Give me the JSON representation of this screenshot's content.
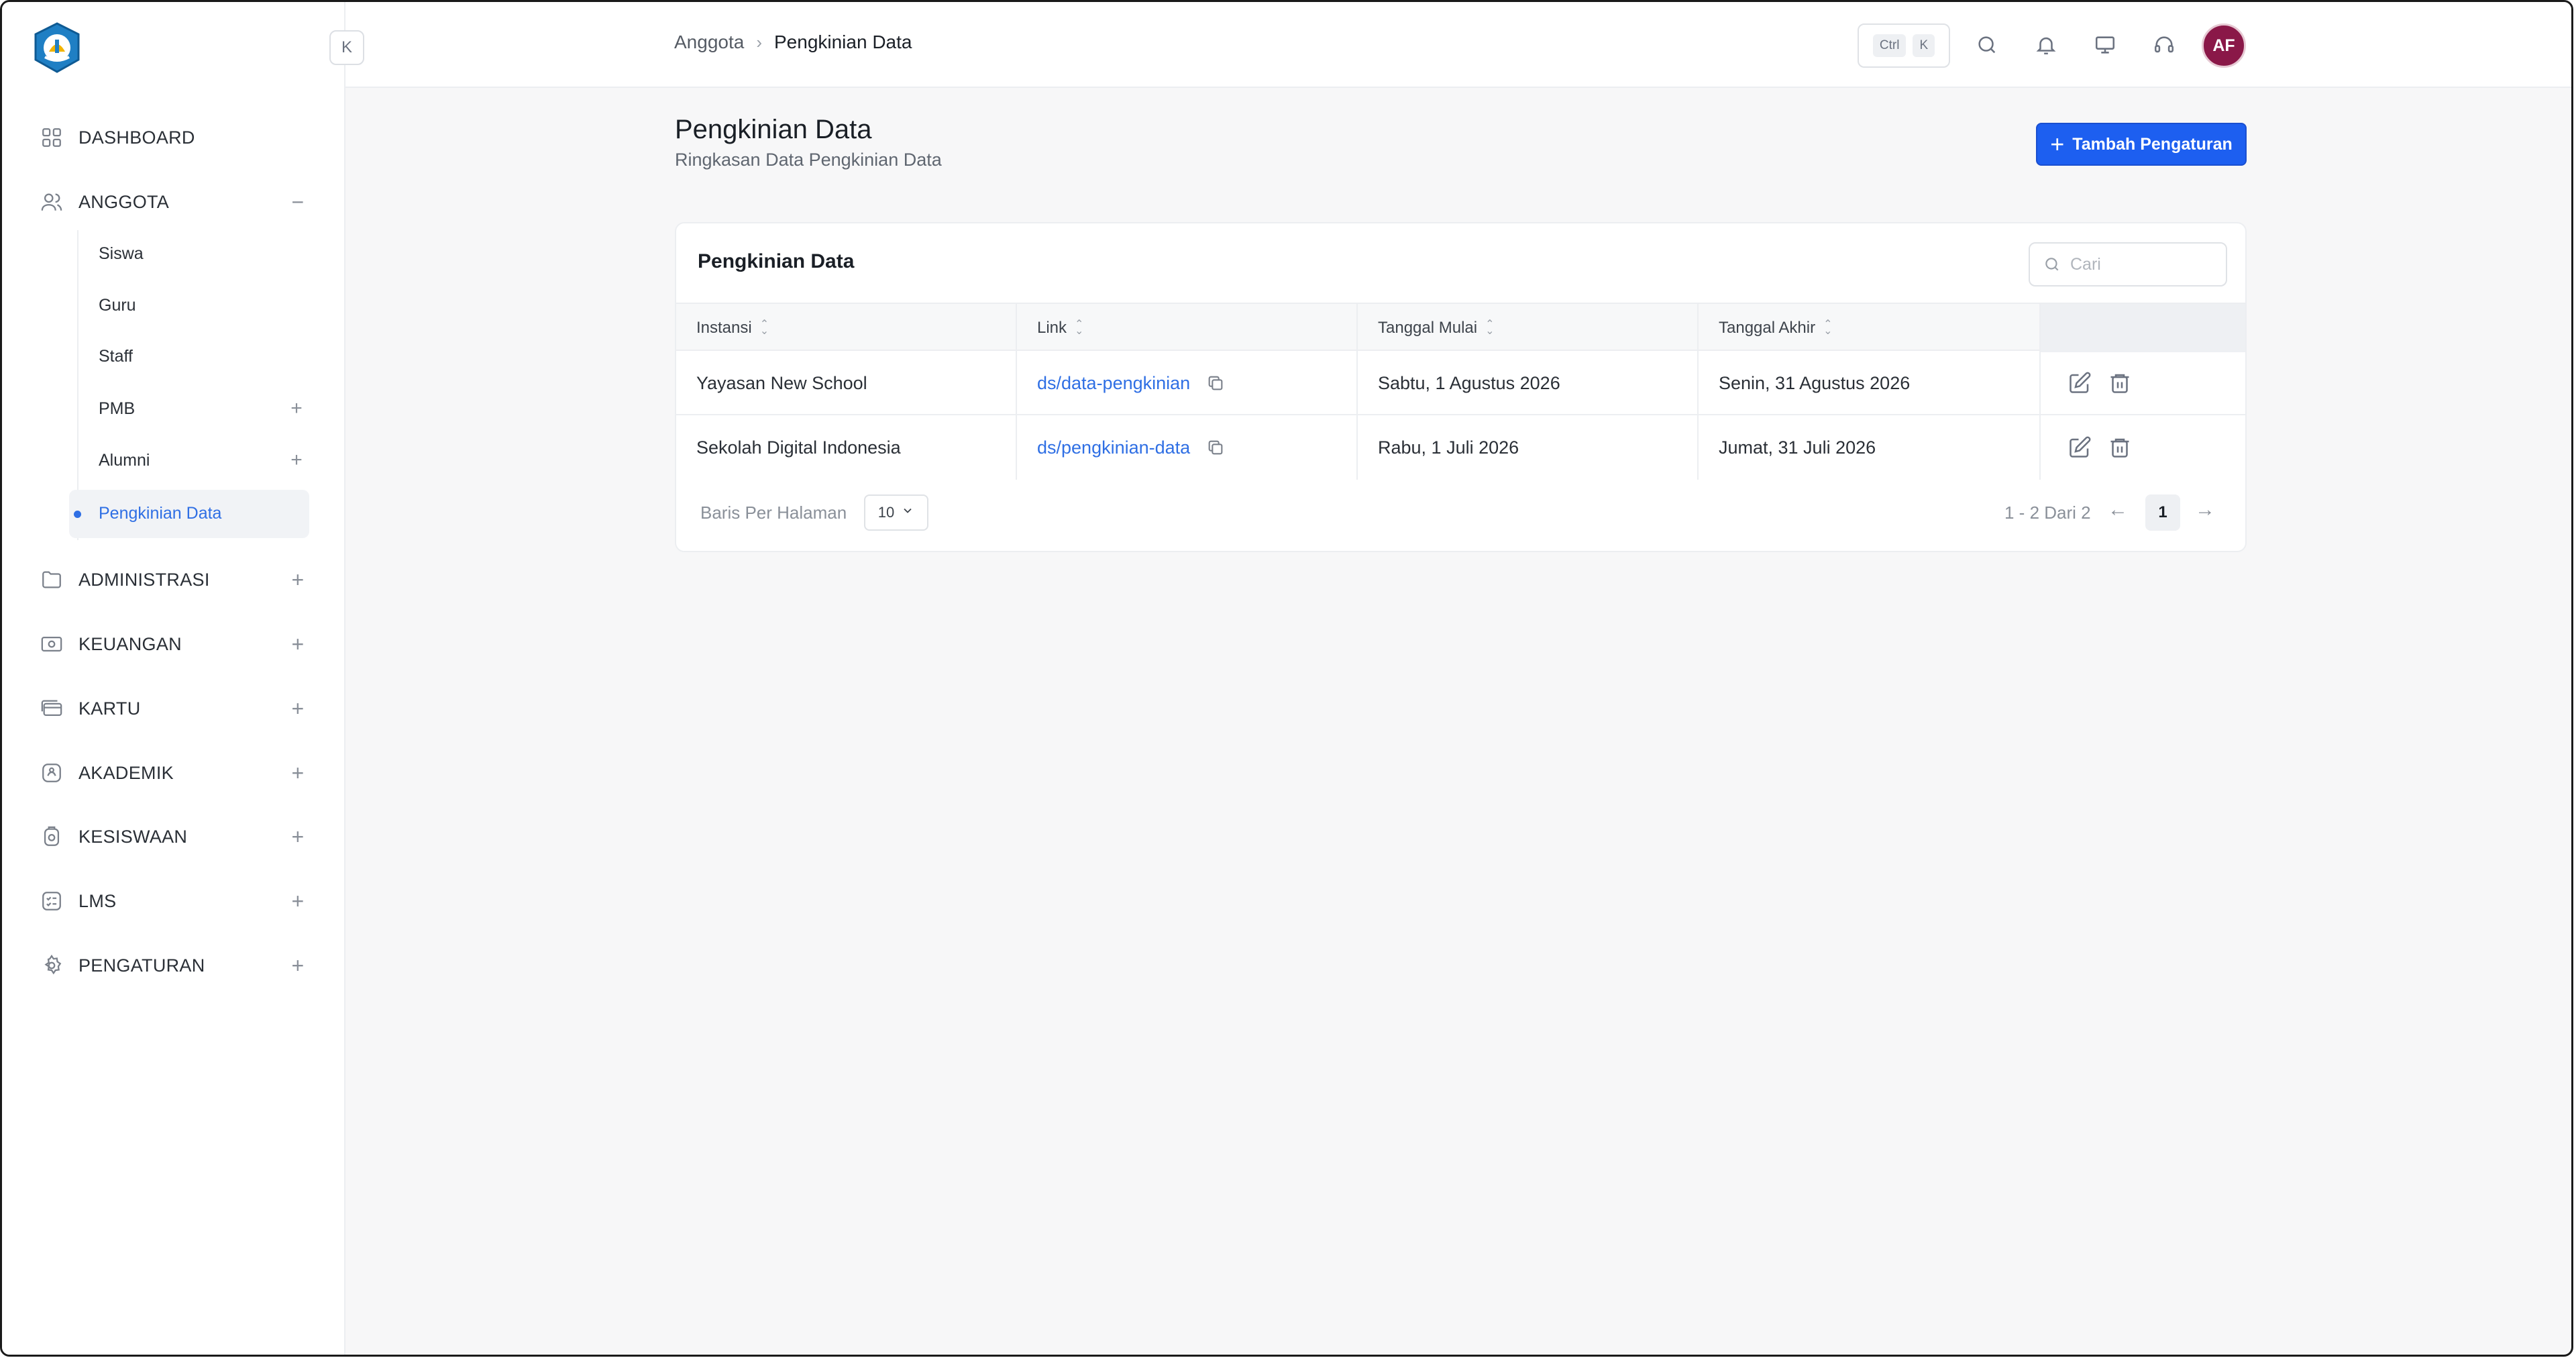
{
  "sidebar": {
    "collapse_label": "K",
    "items": [
      {
        "label": "DASHBOARD",
        "icon": "grid-icon"
      },
      {
        "label": "ANGGOTA",
        "icon": "users-icon",
        "toggle": "−"
      },
      {
        "label": "ADMINISTRASI",
        "icon": "folder-icon",
        "toggle": "+"
      },
      {
        "label": "KEUANGAN",
        "icon": "money-icon",
        "toggle": "+"
      },
      {
        "label": "KARTU",
        "icon": "card-icon",
        "toggle": "+"
      },
      {
        "label": "AKADEMIK",
        "icon": "academic-icon",
        "toggle": "+"
      },
      {
        "label": "KESISWAAN",
        "icon": "medal-icon",
        "toggle": "+"
      },
      {
        "label": "LMS",
        "icon": "checklist-icon",
        "toggle": "+"
      },
      {
        "label": "PENGATURAN",
        "icon": "gear-icon",
        "toggle": "+"
      }
    ],
    "sub_items": [
      {
        "label": "Siswa"
      },
      {
        "label": "Guru"
      },
      {
        "label": "Staff"
      },
      {
        "label": "PMB",
        "toggle": "+"
      },
      {
        "label": "Alumni",
        "toggle": "+"
      },
      {
        "label": "Pengkinian Data",
        "active": true
      }
    ]
  },
  "header": {
    "breadcrumb": [
      "Anggota",
      "Pengkinian Data"
    ],
    "kbd": [
      "Ctrl",
      "K"
    ],
    "avatar_initials": "AF",
    "avatar_color": "#8a1848"
  },
  "main": {
    "title": "Pengkinian Data",
    "subtitle": "Ringkasan Data Pengkinian Data",
    "add_button_label": "Tambah Pengaturan",
    "accent_color": "#1d5ff0",
    "card": {
      "title": "Pengkinian Data",
      "search_placeholder": "Cari",
      "columns": [
        "Instansi",
        "Link",
        "Tanggal Mulai",
        "Tanggal Akhir"
      ],
      "rows": [
        {
          "instansi": "Yayasan New School",
          "link": "ds/data-pengkinian",
          "mulai": "Sabtu, 1 Agustus 2026",
          "akhir": "Senin, 31 Agustus 2026"
        },
        {
          "instansi": "Sekolah Digital Indonesia",
          "link": "ds/pengkinian-data",
          "mulai": "Rabu, 1 Juli 2026",
          "akhir": "Jumat, 31 Juli 2026"
        }
      ],
      "footer": {
        "rows_per_page_label": "Baris Per Halaman",
        "rows_per_page_value": "10",
        "range_text": "1 - 2 Dari 2",
        "current_page": "1"
      }
    }
  }
}
